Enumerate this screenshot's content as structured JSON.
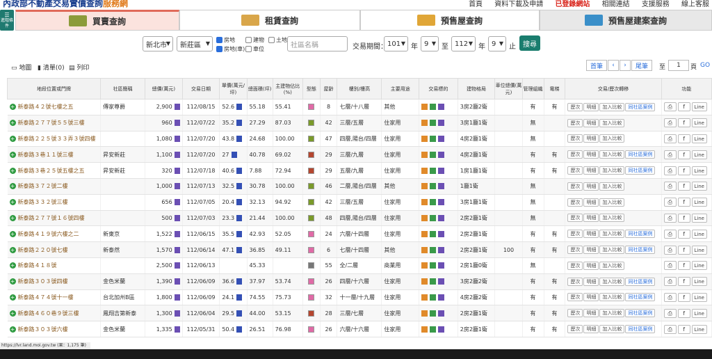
{
  "header": {
    "logo_brand": "內政部",
    "logo_text": "不動產交易實價查詢",
    "logo_hl": "服務網",
    "nav": [
      "首頁",
      "資料下載及申請",
      "已登錄網站",
      "相關連結",
      "支援服務",
      "線上客服"
    ]
  },
  "tabs": [
    {
      "label": "買賣查詢"
    },
    {
      "label": "租賃查詢"
    },
    {
      "label": "預售屋查詢"
    },
    {
      "label": "預售屋建案查詢"
    }
  ],
  "filter_btn": "進階條件",
  "filters": {
    "city": "新北市",
    "district": "新莊區",
    "chk_land": "房地",
    "chk_build": "建物",
    "chk_lot": "土地",
    "chk_landcar": "房地(車)",
    "chk_park": "車位",
    "community_placeholder": "社區名稱",
    "period_label": "交易期間：",
    "from_year": "101",
    "from_month": "9",
    "to_year": "112",
    "to_month": "9",
    "year_lbl": "年",
    "to_lbl": "至",
    "stop_lbl": "止",
    "search": "搜尋"
  },
  "views": {
    "map": "地圖",
    "list": "清單(0)",
    "print": "列印"
  },
  "pager": {
    "first": "首筆",
    "prev": "‹",
    "next": "›",
    "last": "尾筆",
    "to": "至",
    "page": "1",
    "unit": "頁",
    "go": "GO"
  },
  "columns": [
    "地段位置或門牌",
    "社區簡稱",
    "總價(萬元)",
    "交易日期",
    "單價(萬元/坪)",
    "總面積(坪)",
    "主建物佔比(%)",
    "型態",
    "屋齡",
    "樓別/樓高",
    "主要用途",
    "交易標的",
    "建物格局",
    "車位總價(萬元)",
    "管理組織",
    "電梯",
    "交易/歷次轉移",
    "功能"
  ],
  "row_buttons": {
    "history": "歷次",
    "detail": "明細",
    "compare": "加入比較",
    "community": "同社區案例",
    "share_fb": "f",
    "share_line": "Line"
  },
  "rows": [
    {
      "addr": "新泰路４２號七樓之五",
      "comm": "傳家尊爵",
      "price": "2,900",
      "date": "112/08/15",
      "unit": "52.6",
      "area": "55.18",
      "main": "55.41",
      "age": "8",
      "floor": "七層/十八層",
      "use": "其他",
      "layout": "3房2廳2衛",
      "park": "",
      "mgmt": "有",
      "elev": "有",
      "tcol": "#e06aa6"
    },
    {
      "addr": "新泰路２７７號５５號三樓",
      "comm": "",
      "price": "960",
      "date": "112/07/22",
      "unit": "35.2",
      "area": "27.29",
      "main": "87.03",
      "age": "42",
      "floor": "三層/五層",
      "use": "住家用",
      "layout": "3房1廳1衛",
      "park": "",
      "mgmt": "無",
      "elev": "",
      "tcol": "#7a9a2a"
    },
    {
      "addr": "新泰路２２５號３３弄３號四樓",
      "comm": "",
      "price": "1,080",
      "date": "112/07/20",
      "unit": "43.8",
      "area": "24.68",
      "main": "100.00",
      "age": "47",
      "floor": "四層,陽台/四層",
      "use": "住家用",
      "layout": "4房2廳1衛",
      "park": "",
      "mgmt": "無",
      "elev": "",
      "tcol": "#7a9a2a"
    },
    {
      "addr": "新泰路３巷１１號三樓",
      "comm": "昇安新莊",
      "price": "1,100",
      "date": "112/07/20",
      "unit": "27",
      "area": "40.78",
      "main": "69.02",
      "age": "29",
      "floor": "三層/九層",
      "use": "住家用",
      "layout": "4房2廳1衛",
      "park": "",
      "mgmt": "有",
      "elev": "有",
      "tcol": "#b5462f"
    },
    {
      "addr": "新泰路３巷２５號五樓之五",
      "comm": "昇安新莊",
      "price": "320",
      "date": "112/07/18",
      "unit": "40.6",
      "area": "7.88",
      "main": "72.94",
      "age": "29",
      "floor": "五層/九層",
      "use": "住家用",
      "layout": "1房1廳1衛",
      "park": "",
      "mgmt": "有",
      "elev": "有",
      "tcol": "#b5462f"
    },
    {
      "addr": "新泰路３７２號二樓",
      "comm": "",
      "price": "1,000",
      "date": "112/07/13",
      "unit": "32.5",
      "area": "30.78",
      "main": "100.00",
      "age": "46",
      "floor": "二層,陽台/四層",
      "use": "其他",
      "layout": "1廳1衛",
      "park": "",
      "mgmt": "無",
      "elev": "",
      "tcol": "#7a9a2a"
    },
    {
      "addr": "新泰路３３２號三樓",
      "comm": "",
      "price": "656",
      "date": "112/07/05",
      "unit": "20.4",
      "area": "32.13",
      "main": "94.92",
      "age": "42",
      "floor": "三層/五層",
      "use": "住家用",
      "layout": "3房1廳1衛",
      "park": "",
      "mgmt": "無",
      "elev": "",
      "tcol": "#7a9a2a"
    },
    {
      "addr": "新泰路２７７號１６號四樓",
      "comm": "",
      "price": "500",
      "date": "112/07/03",
      "unit": "23.3",
      "area": "21.44",
      "main": "100.00",
      "age": "48",
      "floor": "四層,陽台/四層",
      "use": "住家用",
      "layout": "2房2廳1衛",
      "park": "",
      "mgmt": "無",
      "elev": "",
      "tcol": "#7a9a2a"
    },
    {
      "addr": "新泰路４１９號六樓之二",
      "comm": "新東京",
      "price": "1,522",
      "date": "112/06/15",
      "unit": "35.5",
      "area": "42.93",
      "main": "52.05",
      "age": "24",
      "floor": "六層/十四層",
      "use": "住家用",
      "layout": "2房2廳1衛",
      "park": "",
      "mgmt": "有",
      "elev": "有",
      "tcol": "#e06aa6"
    },
    {
      "addr": "新泰路２２０號七樓",
      "comm": "新泰然",
      "price": "1,570",
      "date": "112/06/14",
      "unit": "47.1",
      "area": "36.85",
      "main": "49.11",
      "age": "6",
      "floor": "七層/十四層",
      "use": "其他",
      "layout": "2房2廳1衛",
      "park": "100",
      "mgmt": "有",
      "elev": "有",
      "tcol": "#e06aa6"
    },
    {
      "addr": "新泰路４１８號",
      "comm": "",
      "price": "2,500",
      "date": "112/06/13",
      "unit": "",
      "area": "45.33",
      "main": "",
      "age": "55",
      "floor": "全/二層",
      "use": "商業用",
      "layout": "2房1廳0衛",
      "park": "",
      "mgmt": "無",
      "elev": "",
      "tcol": "#777777"
    },
    {
      "addr": "新泰路３０３號四樓",
      "comm": "金色米蘭",
      "price": "1,390",
      "date": "112/06/09",
      "unit": "36.6",
      "area": "37.97",
      "main": "53.74",
      "age": "26",
      "floor": "四層/十六層",
      "use": "住家用",
      "layout": "3房2廳2衛",
      "park": "",
      "mgmt": "有",
      "elev": "有",
      "tcol": "#e06aa6"
    },
    {
      "addr": "新泰路４７４號十一樓",
      "comm": "台北加州B區",
      "price": "1,800",
      "date": "112/06/09",
      "unit": "24.1",
      "area": "74.55",
      "main": "75.73",
      "age": "32",
      "floor": "十一層/十九層",
      "use": "住家用",
      "layout": "4房2廳2衛",
      "park": "",
      "mgmt": "有",
      "elev": "有",
      "tcol": "#e06aa6"
    },
    {
      "addr": "新泰路４６０巷９號三樓",
      "comm": "鳳翔吉第新泰",
      "price": "1,300",
      "date": "112/06/04",
      "unit": "29.5",
      "area": "44.00",
      "main": "53.15",
      "age": "28",
      "floor": "三層/七層",
      "use": "住家用",
      "layout": "2房2廳1衛",
      "park": "",
      "mgmt": "有",
      "elev": "有",
      "tcol": "#b5462f"
    },
    {
      "addr": "新泰路３０３號六樓",
      "comm": "金色米蘭",
      "price": "1,335",
      "date": "112/05/31",
      "unit": "50.4",
      "area": "26.51",
      "main": "76.98",
      "age": "26",
      "floor": "六層/十六層",
      "use": "住家用",
      "layout": "2房2廳1衛",
      "park": "",
      "mgmt": "有",
      "elev": "有",
      "tcol": "#e06aa6"
    }
  ],
  "status": "https://lvr.land.moi.gov.tw (果：1,175 筆)"
}
